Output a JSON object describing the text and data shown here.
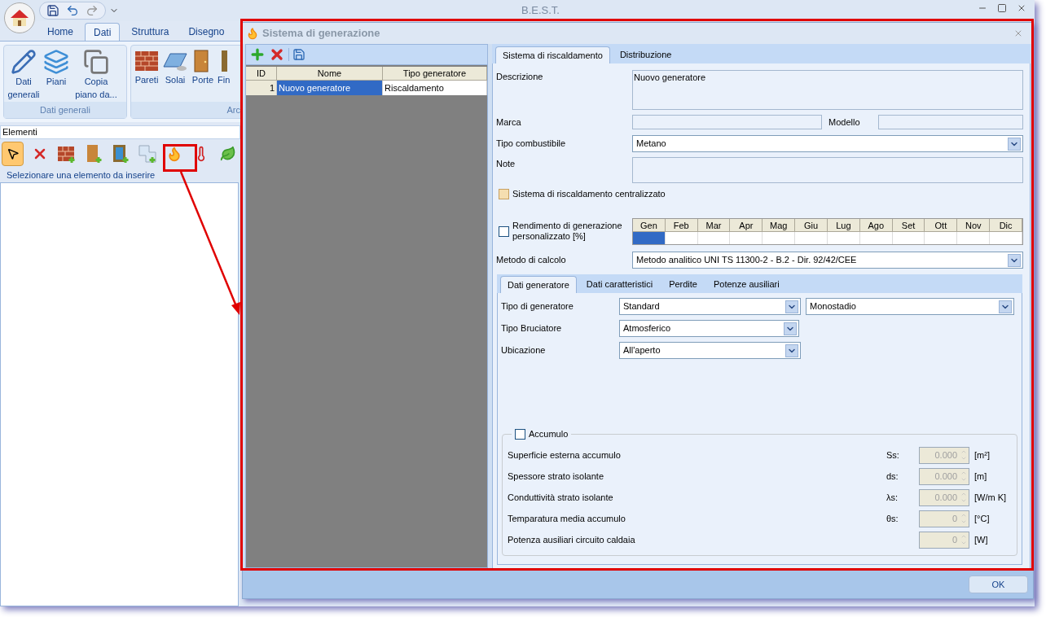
{
  "app": {
    "title": "B.E.S.T.",
    "ribbon_tabs": [
      {
        "label": "Home",
        "selected": false
      },
      {
        "label": "Dati",
        "selected": true
      },
      {
        "label": "Struttura",
        "selected": false
      },
      {
        "label": "Disegno",
        "selected": false
      }
    ],
    "ribbon_groups": [
      {
        "label": "Dati generali",
        "buttons": [
          {
            "kind": "edit",
            "label": "Dati generali"
          },
          {
            "kind": "layers",
            "label": "Piani"
          },
          {
            "kind": "copy",
            "label": "Copia piano da..."
          }
        ]
      },
      {
        "label": "Arc",
        "buttons": [
          {
            "kind": "wall",
            "label": "Pareti"
          },
          {
            "kind": "slab",
            "label": "Solai"
          },
          {
            "kind": "door",
            "label": "Porte"
          },
          {
            "kind": "window",
            "label": "Fin"
          }
        ]
      }
    ],
    "elements_title": "Elementi",
    "tools": [
      {
        "kind": "pointer",
        "selected": true
      },
      {
        "kind": "delete",
        "selected": false
      },
      {
        "kind": "wall",
        "selected": false
      },
      {
        "kind": "door",
        "selected": false
      },
      {
        "kind": "window",
        "selected": false
      },
      {
        "kind": "region",
        "selected": false
      },
      {
        "kind": "flame",
        "selected": false
      },
      {
        "kind": "thermometer",
        "selected": false
      },
      {
        "kind": "leaf",
        "selected": false
      }
    ],
    "hint": "Selezionare una elemento da inserire"
  },
  "dialog": {
    "title": "Sistema di generazione",
    "table": {
      "columns": [
        "ID",
        "Nome",
        "Tipo generatore"
      ],
      "rows": [
        {
          "cells": [
            "1",
            "Nuovo generatore",
            "Riscaldamento"
          ],
          "selected": true
        }
      ]
    },
    "tabs": [
      {
        "label": "Sistema di riscaldamento",
        "selected": true
      },
      {
        "label": "Distribuzione",
        "selected": false
      }
    ],
    "descrizione": {
      "label": "Descrizione",
      "value": "Nuovo generatore"
    },
    "marca": {
      "label": "Marca"
    },
    "modello": {
      "label": "Modello"
    },
    "combustibile": {
      "label": "Tipo combustibile",
      "value": "Metano"
    },
    "note": {
      "label": "Note"
    },
    "centralizzato": {
      "label": "Sistema di riscaldamento centralizzato",
      "checked": false
    },
    "rendimento": {
      "label": "Rendimento di generazione personalizzato [%]",
      "checked": false
    },
    "months": [
      {
        "label": "Gen",
        "selected": true
      },
      {
        "label": "Feb",
        "selected": false
      },
      {
        "label": "Mar",
        "selected": false
      },
      {
        "label": "Apr",
        "selected": false
      },
      {
        "label": "Mag",
        "selected": false
      },
      {
        "label": "Giu",
        "selected": false
      },
      {
        "label": "Lug",
        "selected": false
      },
      {
        "label": "Ago",
        "selected": false
      },
      {
        "label": "Set",
        "selected": false
      },
      {
        "label": "Ott",
        "selected": false
      },
      {
        "label": "Nov",
        "selected": false
      },
      {
        "label": "Dic",
        "selected": false
      }
    ],
    "metodo": {
      "label": "Metodo di calcolo",
      "value": "Metodo analitico UNI TS 11300-2 - B.2 - Dir. 92/42/CEE"
    },
    "subtabs": [
      {
        "label": "Dati generatore",
        "selected": true
      },
      {
        "label": "Dati caratteristici",
        "selected": false
      },
      {
        "label": "Perdite",
        "selected": false
      },
      {
        "label": "Potenze ausiliari",
        "selected": false
      }
    ],
    "tipo_generatore": {
      "label": "Tipo di generatore",
      "value": "Standard",
      "value2": "Monostadio"
    },
    "bruciatore": {
      "label": "Tipo Bruciatore",
      "value": "Atmosferico"
    },
    "ubicazione": {
      "label": "Ubicazione",
      "value": "All'aperto"
    },
    "accumulo": {
      "label": "Accumulo",
      "checked": false,
      "rows": [
        {
          "label": "Superficie esterna accumulo",
          "symbol": "Ss:",
          "value": "0.000",
          "unit": "[m²]",
          "disabled": true
        },
        {
          "label": "Spessore strato isolante",
          "symbol": "ds:",
          "value": "0.000",
          "unit": "[m]",
          "disabled": true
        },
        {
          "label": "Conduttività strato isolante",
          "symbol": "λs:",
          "value": "0.000",
          "unit": "[W/m K]",
          "disabled": true
        },
        {
          "label": "Temparatura media accumulo",
          "symbol": "θs:",
          "value": "0",
          "unit": "[°C]",
          "disabled": true
        },
        {
          "label": "Potenza ausiliari circuito caldaia",
          "value": "0",
          "unit": "[W]",
          "disabled": true
        }
      ]
    },
    "ok": "OK"
  }
}
